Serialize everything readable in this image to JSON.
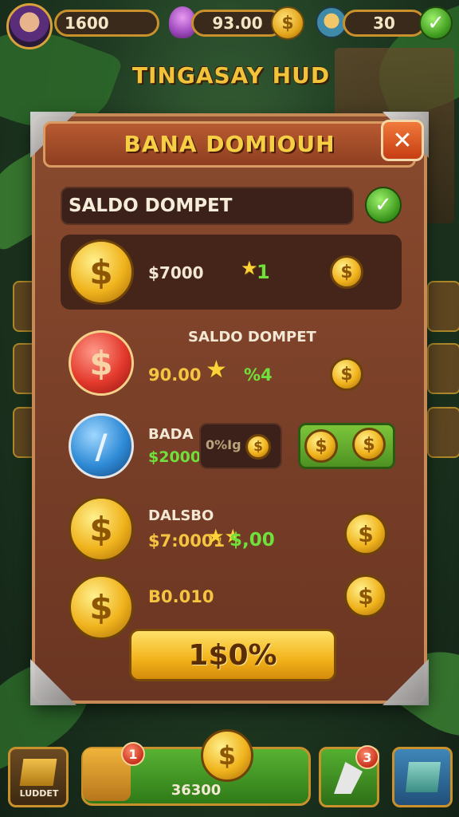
{
  "hud": {
    "coins_value": "1600",
    "gems_value": "93.00",
    "pet_value": "30",
    "coin_symbol": "$",
    "check_symbol": "✓"
  },
  "game_title": "TINGASAY HUD",
  "panel": {
    "title": "BANA DOMIOUH",
    "close_symbol": "✕",
    "wallet_label": "SALDO DOMPET",
    "wallet_check": "✓",
    "row1": {
      "amount": "$7000",
      "bonus": "1"
    },
    "row2": {
      "label": "SALDO DOMPET",
      "amount": "90.00",
      "bonus": "%4"
    },
    "row3": {
      "label": "BADA",
      "amount": "$2000",
      "slot_text": "0%Ig"
    },
    "row4": {
      "label": "DALSBO",
      "amount": "$7:0001",
      "bonus": "$,00"
    },
    "row5": {
      "amount": "B0.010"
    },
    "action_button": "1$0%"
  },
  "bottom": {
    "item1_label": "LUDDET",
    "badge1": "1",
    "center_value": "36300",
    "badge2": "3"
  }
}
